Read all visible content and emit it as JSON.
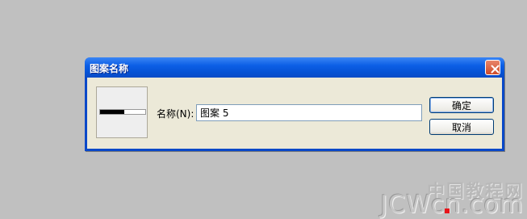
{
  "dialog": {
    "title": "图案名称",
    "close_icon": "close-icon"
  },
  "form": {
    "name_label": "名称(N):",
    "name_value": "图案 5"
  },
  "buttons": {
    "ok_label": "确定",
    "cancel_label": "取消"
  },
  "watermark": {
    "chinese_text": "中国教程网",
    "latin_text": "JCWcn.com"
  },
  "colors": {
    "desktop_background": "#c0c0c0",
    "titlebar_blue": "#0a48c8",
    "client_background": "#ece9d8",
    "close_button": "#d9592f",
    "watermark_dot": "#e8141a"
  }
}
